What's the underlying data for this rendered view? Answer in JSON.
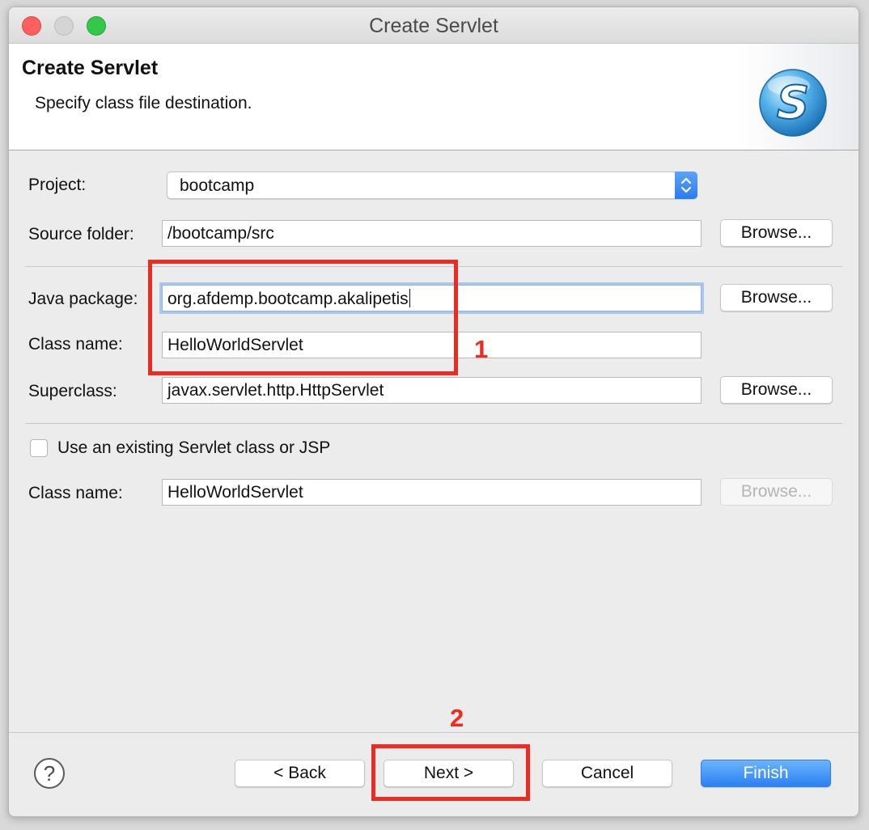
{
  "window": {
    "title": "Create Servlet"
  },
  "banner": {
    "title": "Create Servlet",
    "description": "Specify class file destination."
  },
  "form": {
    "project": {
      "label": "Project:",
      "value": "bootcamp"
    },
    "source_folder": {
      "label": "Source folder:",
      "value": "/bootcamp/src",
      "browse": "Browse..."
    },
    "java_package": {
      "label": "Java package:",
      "value": "org.afdemp.bootcamp.akalipetis",
      "browse": "Browse..."
    },
    "class_name": {
      "label": "Class name:",
      "value": "HelloWorldServlet"
    },
    "superclass": {
      "label": "Superclass:",
      "value": "javax.servlet.http.HttpServlet",
      "browse": "Browse..."
    },
    "existing": {
      "checkbox_label": "Use an existing Servlet class or JSP",
      "checked": false,
      "class_label": "Class name:",
      "class_value": "HelloWorldServlet",
      "browse": "Browse..."
    }
  },
  "footer": {
    "help": "?",
    "back": "< Back",
    "next": "Next >",
    "cancel": "Cancel",
    "finish": "Finish"
  },
  "annotations": {
    "step1": "1",
    "step2": "2"
  },
  "colors": {
    "highlight": "#f02a1e",
    "accent": "#2a81f3"
  }
}
